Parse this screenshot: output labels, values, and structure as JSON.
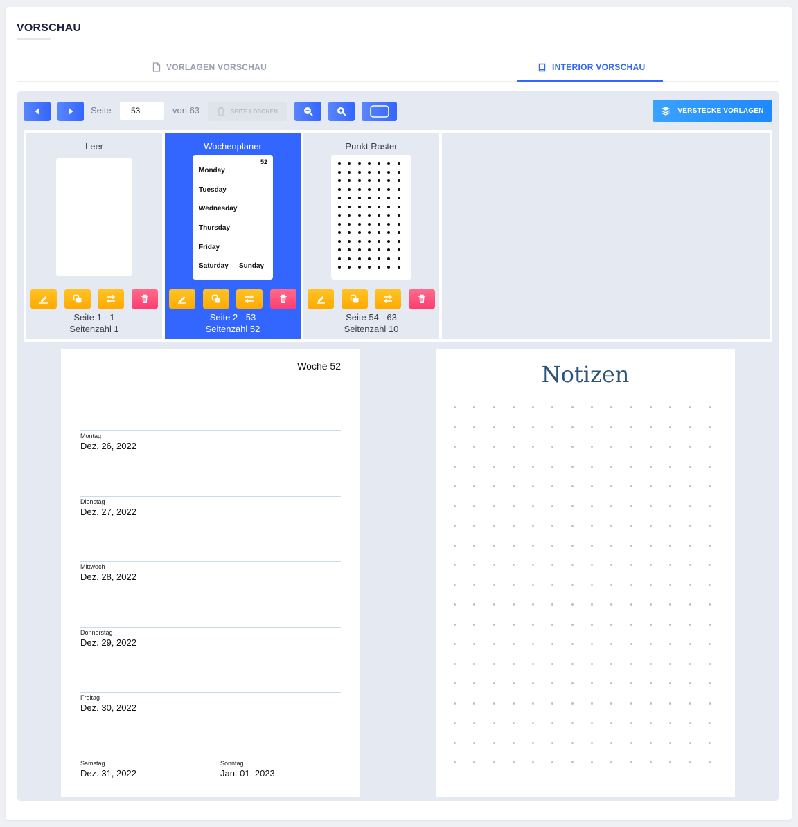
{
  "header": {
    "title": "VORSCHAU"
  },
  "tabs": [
    {
      "label": "VORLAGEN VORSCHAU",
      "active": false,
      "icon": "file-icon"
    },
    {
      "label": "INTERIOR VORSCHAU",
      "active": true,
      "icon": "book-icon"
    }
  ],
  "toolbar": {
    "page_label": "Seite",
    "page_value": "53",
    "of_label": "von 63",
    "delete_page_label": "SEITE LÖSCHEN",
    "hide_templates_label": "VERSTECKE VORLAGEN"
  },
  "templates": [
    {
      "name": "Leer",
      "range": "Seite 1 - 1",
      "count": "Seitenzahl 1",
      "active": false
    },
    {
      "name": "Wochenplaner",
      "range": "Seite 2 - 53",
      "count": "Seitenzahl 52",
      "active": true,
      "thumb": {
        "number": "52",
        "days": [
          "Monday",
          "Tuesday",
          "Wednesday",
          "Thursday",
          "Friday",
          "Saturday"
        ],
        "last_day": "Sunday"
      }
    },
    {
      "name": "Punkt Raster",
      "range": "Seite 54 - 63",
      "count": "Seitenzahl 10",
      "active": false
    }
  ],
  "left_page": {
    "week": "Woche 52",
    "days": [
      {
        "name": "Montag",
        "date": "Dez. 26, 2022"
      },
      {
        "name": "Dienstag",
        "date": "Dez. 27, 2022"
      },
      {
        "name": "Mittwoch",
        "date": "Dez. 28, 2022"
      },
      {
        "name": "Donnerstag",
        "date": "Dez. 29, 2022"
      },
      {
        "name": "Freitag",
        "date": "Dez. 30, 2022"
      },
      {
        "name": "Samstag",
        "date": "Dez. 31, 2022"
      },
      {
        "name": "Sonntag",
        "date": "Jan. 01, 2023"
      }
    ]
  },
  "right_page": {
    "title": "Notizen"
  },
  "colors": {
    "primary": "#3366ff",
    "edit": "#ffaa00",
    "delete": "#ff3d71",
    "panel": "#e4e9f2",
    "notes_title": "#2c5577"
  }
}
